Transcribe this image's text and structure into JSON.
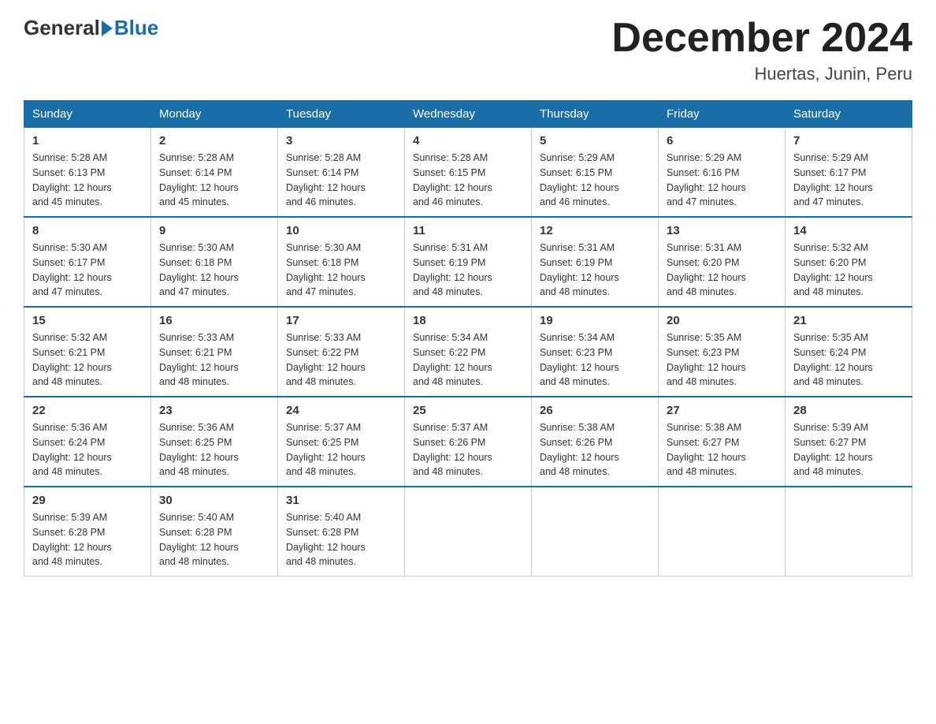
{
  "logo": {
    "general": "General",
    "blue": "Blue"
  },
  "title": "December 2024",
  "location": "Huertas, Junin, Peru",
  "days_of_week": [
    "Sunday",
    "Monday",
    "Tuesday",
    "Wednesday",
    "Thursday",
    "Friday",
    "Saturday"
  ],
  "weeks": [
    [
      {
        "day": "1",
        "sunrise": "5:28 AM",
        "sunset": "6:13 PM",
        "daylight": "12 hours and 45 minutes."
      },
      {
        "day": "2",
        "sunrise": "5:28 AM",
        "sunset": "6:14 PM",
        "daylight": "12 hours and 45 minutes."
      },
      {
        "day": "3",
        "sunrise": "5:28 AM",
        "sunset": "6:14 PM",
        "daylight": "12 hours and 46 minutes."
      },
      {
        "day": "4",
        "sunrise": "5:28 AM",
        "sunset": "6:15 PM",
        "daylight": "12 hours and 46 minutes."
      },
      {
        "day": "5",
        "sunrise": "5:29 AM",
        "sunset": "6:15 PM",
        "daylight": "12 hours and 46 minutes."
      },
      {
        "day": "6",
        "sunrise": "5:29 AM",
        "sunset": "6:16 PM",
        "daylight": "12 hours and 47 minutes."
      },
      {
        "day": "7",
        "sunrise": "5:29 AM",
        "sunset": "6:17 PM",
        "daylight": "12 hours and 47 minutes."
      }
    ],
    [
      {
        "day": "8",
        "sunrise": "5:30 AM",
        "sunset": "6:17 PM",
        "daylight": "12 hours and 47 minutes."
      },
      {
        "day": "9",
        "sunrise": "5:30 AM",
        "sunset": "6:18 PM",
        "daylight": "12 hours and 47 minutes."
      },
      {
        "day": "10",
        "sunrise": "5:30 AM",
        "sunset": "6:18 PM",
        "daylight": "12 hours and 47 minutes."
      },
      {
        "day": "11",
        "sunrise": "5:31 AM",
        "sunset": "6:19 PM",
        "daylight": "12 hours and 48 minutes."
      },
      {
        "day": "12",
        "sunrise": "5:31 AM",
        "sunset": "6:19 PM",
        "daylight": "12 hours and 48 minutes."
      },
      {
        "day": "13",
        "sunrise": "5:31 AM",
        "sunset": "6:20 PM",
        "daylight": "12 hours and 48 minutes."
      },
      {
        "day": "14",
        "sunrise": "5:32 AM",
        "sunset": "6:20 PM",
        "daylight": "12 hours and 48 minutes."
      }
    ],
    [
      {
        "day": "15",
        "sunrise": "5:32 AM",
        "sunset": "6:21 PM",
        "daylight": "12 hours and 48 minutes."
      },
      {
        "day": "16",
        "sunrise": "5:33 AM",
        "sunset": "6:21 PM",
        "daylight": "12 hours and 48 minutes."
      },
      {
        "day": "17",
        "sunrise": "5:33 AM",
        "sunset": "6:22 PM",
        "daylight": "12 hours and 48 minutes."
      },
      {
        "day": "18",
        "sunrise": "5:34 AM",
        "sunset": "6:22 PM",
        "daylight": "12 hours and 48 minutes."
      },
      {
        "day": "19",
        "sunrise": "5:34 AM",
        "sunset": "6:23 PM",
        "daylight": "12 hours and 48 minutes."
      },
      {
        "day": "20",
        "sunrise": "5:35 AM",
        "sunset": "6:23 PM",
        "daylight": "12 hours and 48 minutes."
      },
      {
        "day": "21",
        "sunrise": "5:35 AM",
        "sunset": "6:24 PM",
        "daylight": "12 hours and 48 minutes."
      }
    ],
    [
      {
        "day": "22",
        "sunrise": "5:36 AM",
        "sunset": "6:24 PM",
        "daylight": "12 hours and 48 minutes."
      },
      {
        "day": "23",
        "sunrise": "5:36 AM",
        "sunset": "6:25 PM",
        "daylight": "12 hours and 48 minutes."
      },
      {
        "day": "24",
        "sunrise": "5:37 AM",
        "sunset": "6:25 PM",
        "daylight": "12 hours and 48 minutes."
      },
      {
        "day": "25",
        "sunrise": "5:37 AM",
        "sunset": "6:26 PM",
        "daylight": "12 hours and 48 minutes."
      },
      {
        "day": "26",
        "sunrise": "5:38 AM",
        "sunset": "6:26 PM",
        "daylight": "12 hours and 48 minutes."
      },
      {
        "day": "27",
        "sunrise": "5:38 AM",
        "sunset": "6:27 PM",
        "daylight": "12 hours and 48 minutes."
      },
      {
        "day": "28",
        "sunrise": "5:39 AM",
        "sunset": "6:27 PM",
        "daylight": "12 hours and 48 minutes."
      }
    ],
    [
      {
        "day": "29",
        "sunrise": "5:39 AM",
        "sunset": "6:28 PM",
        "daylight": "12 hours and 48 minutes."
      },
      {
        "day": "30",
        "sunrise": "5:40 AM",
        "sunset": "6:28 PM",
        "daylight": "12 hours and 48 minutes."
      },
      {
        "day": "31",
        "sunrise": "5:40 AM",
        "sunset": "6:28 PM",
        "daylight": "12 hours and 48 minutes."
      },
      null,
      null,
      null,
      null
    ]
  ],
  "labels": {
    "sunrise": "Sunrise:",
    "sunset": "Sunset:",
    "daylight": "Daylight:"
  }
}
